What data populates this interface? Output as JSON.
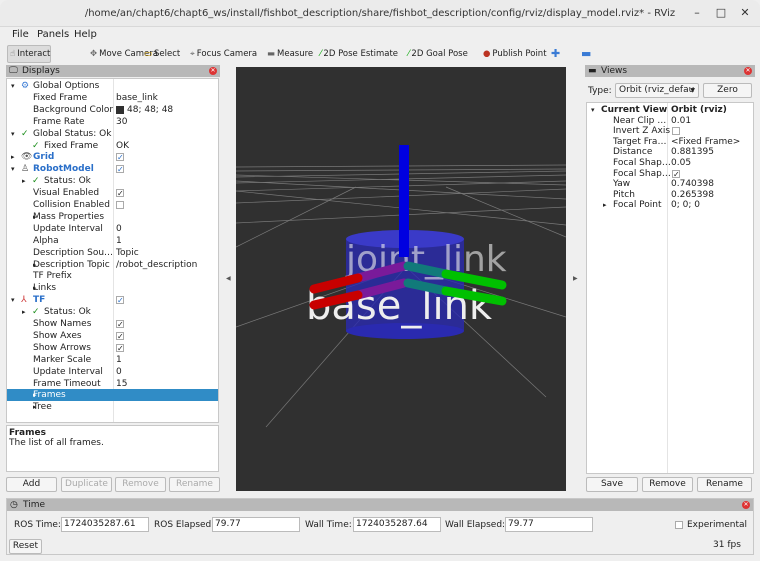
{
  "window": {
    "title": "/home/an/chapt6/chapt6_ws/install/fishbot_description/share/fishbot_description/config/rviz/display_model.rviz* - RViz",
    "minimize": "–",
    "maximize": "□",
    "close": "✕"
  },
  "menu": [
    "File",
    "Panels",
    "Help"
  ],
  "toolbar": [
    {
      "label": "Interact",
      "icon": "hand-icon",
      "active": true
    },
    {
      "label": "Move Camera",
      "icon": "move-camera-icon"
    },
    {
      "label": "Select",
      "icon": "select-icon"
    },
    {
      "label": "Focus Camera",
      "icon": "focus-camera-icon"
    },
    {
      "label": "Measure",
      "icon": "ruler-icon"
    },
    {
      "label": "2D Pose Estimate",
      "icon": "green-arrow-icon"
    },
    {
      "label": "2D Goal Pose",
      "icon": "green-arrow-icon"
    },
    {
      "label": "Publish Point",
      "icon": "map-pin-icon"
    }
  ],
  "displays": {
    "title": "Displays",
    "rows": [
      {
        "label": "Global Options",
        "value": "",
        "indent": 0,
        "exp": "open",
        "icon": "gear"
      },
      {
        "label": "Fixed Frame",
        "value": "base_link",
        "indent": 2
      },
      {
        "label": "Background Color",
        "value": "48; 48; 48",
        "indent": 2,
        "swatch": "#303030"
      },
      {
        "label": "Frame Rate",
        "value": "30",
        "indent": 2
      },
      {
        "label": "Global Status: Ok",
        "value": "",
        "indent": 0,
        "exp": "open",
        "icon": "check"
      },
      {
        "label": "Fixed Frame",
        "value": "OK",
        "indent": 1,
        "icon": "check"
      },
      {
        "label": "Grid",
        "value": "",
        "indent": 0,
        "exp": "closed",
        "icon": "eye",
        "blue": true,
        "check": true
      },
      {
        "label": "RobotModel",
        "value": "",
        "indent": 0,
        "exp": "open",
        "icon": "robot",
        "blue": true,
        "check": true
      },
      {
        "label": "Status: Ok",
        "value": "",
        "indent": 1,
        "exp": "closed",
        "icon": "check"
      },
      {
        "label": "Visual Enabled",
        "value": "",
        "indent": 2,
        "check": true
      },
      {
        "label": "Collision Enabled",
        "value": "",
        "indent": 2,
        "check": false
      },
      {
        "label": "Mass Properties",
        "value": "",
        "indent": 2,
        "exp": "closed"
      },
      {
        "label": "Update Interval",
        "value": "0",
        "indent": 2
      },
      {
        "label": "Alpha",
        "value": "1",
        "indent": 2
      },
      {
        "label": "Description Sou…",
        "value": "Topic",
        "indent": 2
      },
      {
        "label": "Description Topic",
        "value": "/robot_description",
        "indent": 2,
        "exp": "closed"
      },
      {
        "label": "TF Prefix",
        "value": "",
        "indent": 2
      },
      {
        "label": "Links",
        "value": "",
        "indent": 2,
        "exp": "closed"
      },
      {
        "label": "TF",
        "value": "",
        "indent": 0,
        "exp": "open",
        "icon": "axes",
        "blue": true,
        "check": true
      },
      {
        "label": "Status: Ok",
        "value": "",
        "indent": 1,
        "exp": "closed",
        "icon": "check"
      },
      {
        "label": "Show Names",
        "value": "",
        "indent": 2,
        "check": true
      },
      {
        "label": "Show Axes",
        "value": "",
        "indent": 2,
        "check": true
      },
      {
        "label": "Show Arrows",
        "value": "",
        "indent": 2,
        "check": true
      },
      {
        "label": "Marker Scale",
        "value": "1",
        "indent": 2
      },
      {
        "label": "Update Interval",
        "value": "0",
        "indent": 2
      },
      {
        "label": "Frame Timeout",
        "value": "15",
        "indent": 2
      },
      {
        "label": "Frames",
        "value": "",
        "indent": 2,
        "exp": "closed",
        "selected": true
      },
      {
        "label": "Tree",
        "value": "",
        "indent": 2,
        "exp": "closed"
      }
    ],
    "desc_title": "Frames",
    "desc_text": "The list of all frames.",
    "buttons": [
      {
        "label": "Add",
        "enabled": true
      },
      {
        "label": "Duplicate",
        "enabled": false
      },
      {
        "label": "Remove",
        "enabled": false
      },
      {
        "label": "Rename",
        "enabled": false
      }
    ]
  },
  "viewport": {
    "background": "#303030",
    "frame_label": "base_link"
  },
  "views": {
    "title": "Views",
    "type_label": "Type:",
    "type_value": "Orbit (rviz_defau",
    "zero": "Zero",
    "rows": [
      {
        "label": "Current View",
        "value": "Orbit (rviz)",
        "head": true
      },
      {
        "label": "Near Clip …",
        "value": "0.01"
      },
      {
        "label": "Invert Z Axis",
        "value": "",
        "check": false
      },
      {
        "label": "Target Fra…",
        "value": "<Fixed Frame>"
      },
      {
        "label": "Distance",
        "value": "0.881395"
      },
      {
        "label": "Focal Shap…",
        "value": "0.05"
      },
      {
        "label": "Focal Shap…",
        "value": "",
        "check": true
      },
      {
        "label": "Yaw",
        "value": "0.740398"
      },
      {
        "label": "Pitch",
        "value": "0.265398"
      },
      {
        "label": "Focal Point",
        "value": "0; 0; 0",
        "exp": true
      }
    ],
    "buttons": [
      "Save",
      "Remove",
      "Rename"
    ]
  },
  "time": {
    "title": "Time",
    "ros_time_label": "ROS Time:",
    "ros_time": "1724035287.61",
    "ros_elapsed_label": "ROS Elapsed:",
    "ros_elapsed": "79.77",
    "wall_time_label": "Wall Time:",
    "wall_time": "1724035287.64",
    "wall_elapsed_label": "Wall Elapsed:",
    "wall_elapsed": "79.77",
    "experimental": "Experimental",
    "reset": "Reset",
    "fps": "31 fps"
  }
}
